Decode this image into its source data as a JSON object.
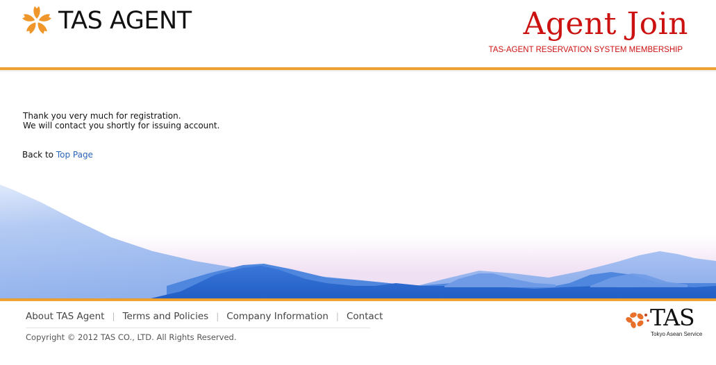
{
  "header": {
    "logo_text": "TAS AGENT",
    "title": "Agent Join",
    "subtitle": "TAS-AGENT RESERVATION SYSTEM MEMBERSHIP"
  },
  "main": {
    "message_line1": "Thank you very much for registration.",
    "message_line2": "We will contact you shortly for issuing account.",
    "back_prefix": "Back to",
    "back_link": "Top Page"
  },
  "footer": {
    "nav": [
      "About TAS Agent",
      "Terms and Policies",
      "Company Information",
      "Contact"
    ],
    "separator": "|",
    "copyright": "Copyright © 2012 TAS CO., LTD. All Rights Reserved.",
    "logo_text": "TAS",
    "logo_caption": "Tokyo Asean Service"
  },
  "colors": {
    "accent_orange": "#f0a030",
    "title_red": "#cc1111",
    "link_blue": "#2a63b8",
    "mountain_dark_blue": "#2f6cd0",
    "mountain_light_blue": "#9fbdf0"
  },
  "icons": {
    "header_logo": "sakura-flower-icon",
    "footer_logo": "sakura-flower-icon"
  }
}
